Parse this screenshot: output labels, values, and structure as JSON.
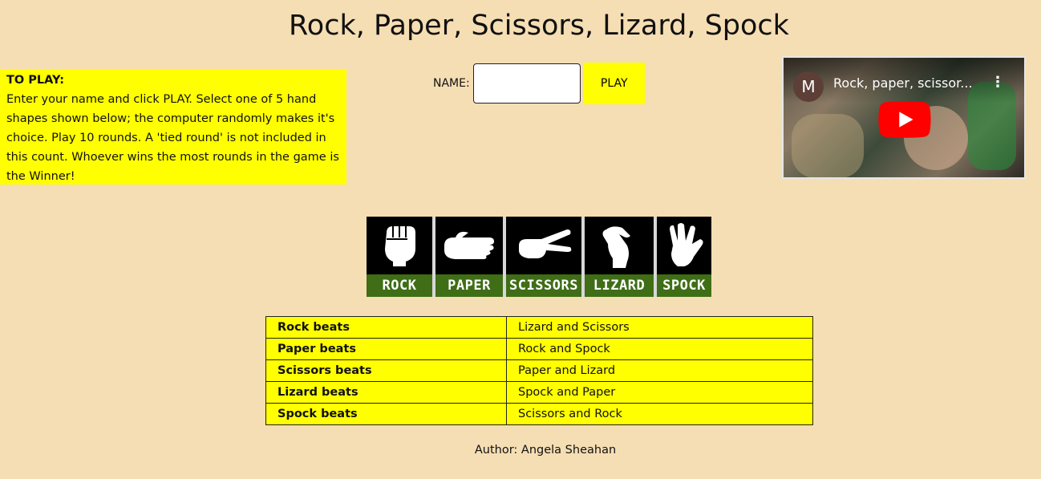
{
  "page": {
    "title": "Rock, Paper, Scissors, Lizard, Spock"
  },
  "instructions": {
    "heading": "TO PLAY:",
    "body": "Enter your name and click PLAY. Select one of 5 hand shapes shown below; the computer randomly makes it's choice. Play 10 rounds. A 'tied round' is not included in this count. Whoever wins the most rounds in the game is the Winner!"
  },
  "controls": {
    "name_label": "NAME:",
    "name_value": "",
    "play_label": "PLAY"
  },
  "video": {
    "avatar_letter": "M",
    "title": "Rock, paper, scissor...",
    "menu_glyph": "⋮"
  },
  "hands": [
    {
      "label": "ROCK"
    },
    {
      "label": "PAPER"
    },
    {
      "label": "SCISSORS"
    },
    {
      "label": "LIZARD"
    },
    {
      "label": "SPOCK"
    }
  ],
  "rules": [
    {
      "beats": "Rock beats",
      "victims": "Lizard and Scissors"
    },
    {
      "beats": "Paper beats",
      "victims": "Rock and Spock"
    },
    {
      "beats": "Scissors beats",
      "victims": "Paper and Lizard"
    },
    {
      "beats": "Lizard beats",
      "victims": "Spock and Paper"
    },
    {
      "beats": "Spock beats",
      "victims": "Scissors and Rock"
    }
  ],
  "footer": {
    "author": "Author: Angela Sheahan"
  },
  "colors": {
    "background": "#f5deb3",
    "highlight": "#ffff00",
    "hand_label_bg": "#3f6e16",
    "youtube_red": "#ff0000"
  }
}
